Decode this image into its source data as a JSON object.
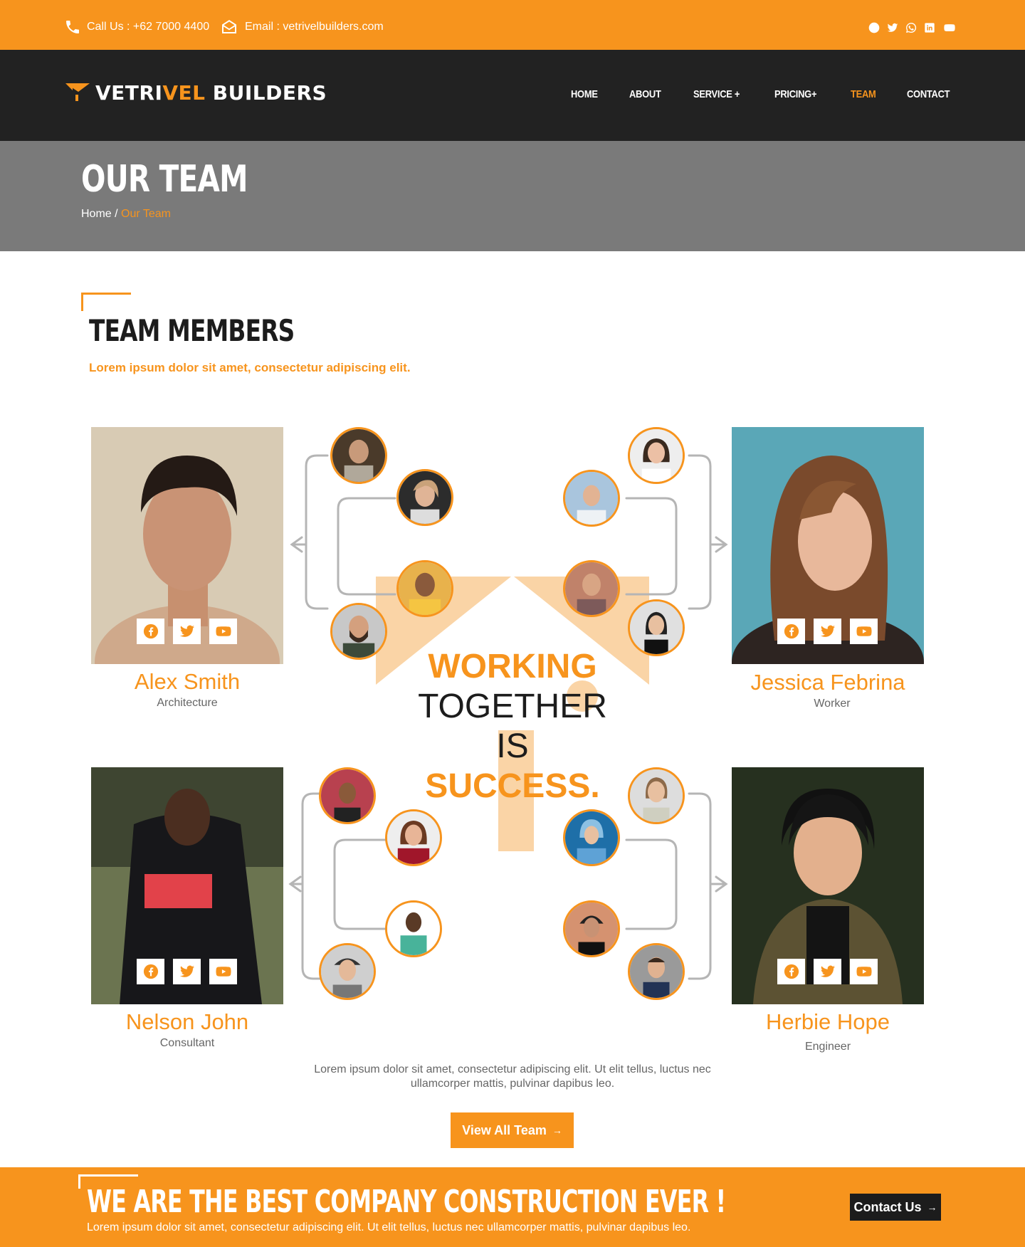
{
  "topbar": {
    "phone": "Call Us : +62 7000 4400",
    "email": "Email : vetrivelbuilders.com",
    "socials": [
      "facebook-icon",
      "twitter-icon",
      "whatsapp-icon",
      "linkedin-icon",
      "youtube-icon"
    ]
  },
  "brand": {
    "part1": "VETRI",
    "part2": "VEL",
    "part3": " BUILDERS"
  },
  "nav": {
    "home": "HOME",
    "about": "ABOUT",
    "service": "SERVICE +",
    "pricing": "PRICING+",
    "team": "TEAM",
    "contact": "CONTACT"
  },
  "banner": {
    "title": "OUR TEAM",
    "crumb_home": "Home /",
    "crumb_current": "Our Team"
  },
  "section": {
    "title": "TEAM MEMBERS",
    "subtitle": "Lorem ipsum dolor sit amet, consectetur adipiscing elit."
  },
  "members": [
    {
      "name": "Alex Smith",
      "role": "Architecture"
    },
    {
      "name": "Jessica Febrina",
      "role": "Worker"
    },
    {
      "name": "Nelson John",
      "role": "Consultant"
    },
    {
      "name": "Herbie Hope",
      "role": "Engineer"
    }
  ],
  "slogan": {
    "line1": "WORKING",
    "line2": "TOGETHER",
    "line3": "IS",
    "line4": "SUCCESS."
  },
  "description": "Lorem ipsum dolor sit amet, consectetur adipiscing elit. Ut elit tellus, luctus nec ullamcorper mattis, pulvinar dapibus leo.",
  "view_all_label": "View All Team",
  "cta": {
    "title": "WE ARE THE BEST COMPANY CONSTRUCTION EVER !",
    "text": "Lorem ipsum dolor sit amet, consectetur adipiscing elit. Ut elit tellus, luctus nec ullamcorper mattis, pulvinar dapibus leo.",
    "button": "Contact Us"
  },
  "colors": {
    "accent": "#F7941D",
    "dark": "#222222",
    "banner": "#7a7a7a"
  }
}
